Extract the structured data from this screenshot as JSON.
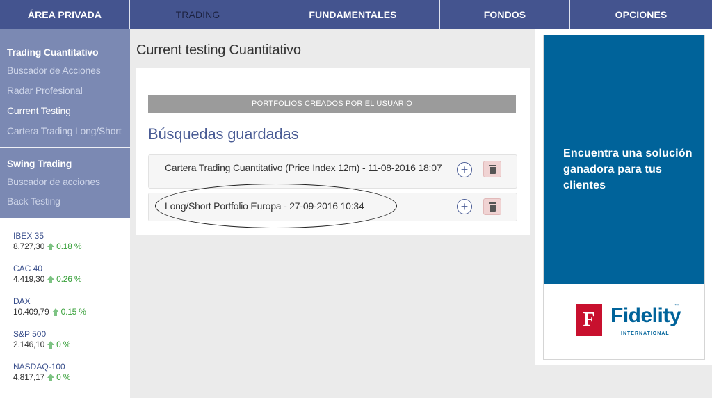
{
  "nav": {
    "tabs": [
      {
        "label": "ÁREA PRIVADA"
      },
      {
        "label": "TRADING"
      },
      {
        "label": "FUNDAMENTALES"
      },
      {
        "label": "FONDOS"
      },
      {
        "label": "OPCIONES"
      }
    ],
    "active": "TRADING"
  },
  "sidebar": {
    "groups": [
      {
        "head": "Trading Cuantitativo",
        "items": [
          "Buscador de Acciones",
          "Radar Profesional",
          "Current Testing",
          "Cartera Trading Long/Short"
        ]
      },
      {
        "head": "Swing Trading",
        "items": [
          "Buscador de acciones",
          "Back Testing"
        ]
      }
    ],
    "current_item": "Current Testing"
  },
  "tickers": [
    {
      "name": "IBEX 35",
      "value": "8.727,30",
      "change": "0.18 %"
    },
    {
      "name": "CAC 40",
      "value": "4.419,30",
      "change": "0.26 %"
    },
    {
      "name": "DAX",
      "value": "10.409,79",
      "change": "0.15 %"
    },
    {
      "name": "S&P 500",
      "value": "2.146,10",
      "change": "0 %"
    },
    {
      "name": "NASDAQ-100",
      "value": "4.817,17",
      "change": "0 %"
    }
  ],
  "main": {
    "title": "Current testing Cuantitativo",
    "banner": "PORTFOLIOS CREADOS POR EL USUARIO",
    "saved_title": "Búsquedas guardadas",
    "rows": [
      {
        "text": "Cartera Trading Cuantitativo (Price Index 12m) - 11-08-2016 18:07"
      },
      {
        "text": "Long/Short Portfolio Europa - 27-09-2016 10:34"
      }
    ],
    "add_symbol": "+"
  },
  "ad": {
    "headline": "Encuentra una solución ganadora para tus clientes",
    "logo_mark": "F",
    "logo_word": "Fidelity",
    "logo_tm": "™",
    "logo_sub": "INTERNATIONAL",
    "brand_color": "#00639a",
    "logo_red": "#c8102e"
  },
  "colors": {
    "nav": "#44548f",
    "sidebar": "#7b89b3",
    "positive": "#38a03a"
  }
}
